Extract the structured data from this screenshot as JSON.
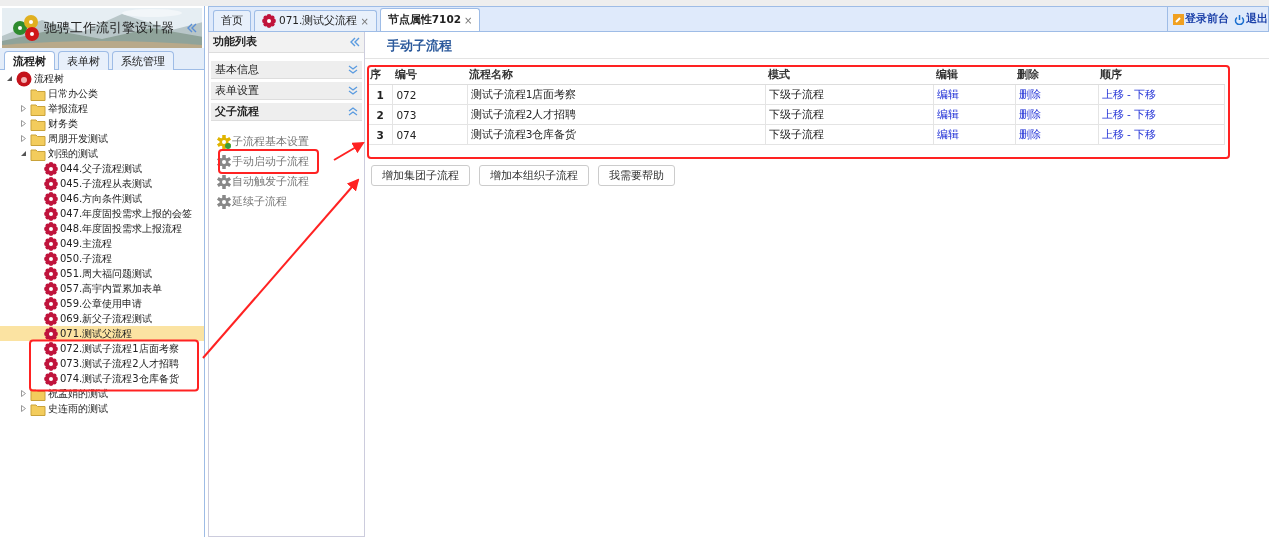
{
  "sidebar": {
    "title": "驰骋工作流引擎设计器",
    "tabs": [
      {
        "label": "流程树",
        "selected": true
      },
      {
        "label": "表单树",
        "selected": false
      },
      {
        "label": "系统管理",
        "selected": false
      }
    ],
    "tree": [
      {
        "label": "流程树",
        "kind": "root",
        "expanded": true,
        "selected": false,
        "children": [
          {
            "label": "日常办公类",
            "kind": "folder",
            "selected": false
          },
          {
            "label": "举报流程",
            "kind": "folder",
            "expanded": false,
            "selected": false
          },
          {
            "label": "财务类",
            "kind": "folder",
            "expanded": false,
            "selected": false
          },
          {
            "label": "周朋开发测试",
            "kind": "folder",
            "expanded": false,
            "selected": false
          },
          {
            "label": "刘强的测试",
            "kind": "folder",
            "expanded": true,
            "selected": false,
            "children": [
              {
                "label": "044.父子流程测试",
                "kind": "process",
                "selected": false
              },
              {
                "label": "045.子流程从表测试",
                "kind": "process",
                "selected": false
              },
              {
                "label": "046.方向条件测试",
                "kind": "process",
                "selected": false
              },
              {
                "label": "047.年度固投需求上报的会签",
                "kind": "process",
                "selected": false
              },
              {
                "label": "048.年度固投需求上报流程",
                "kind": "process",
                "selected": false
              },
              {
                "label": "049.主流程",
                "kind": "process",
                "selected": false
              },
              {
                "label": "050.子流程",
                "kind": "process",
                "selected": false
              },
              {
                "label": "051.周大福问题测试",
                "kind": "process",
                "selected": false
              },
              {
                "label": "057.高宇内置累加表单",
                "kind": "process",
                "selected": false
              },
              {
                "label": "059.公章使用申请",
                "kind": "process",
                "selected": false
              },
              {
                "label": "069.新父子流程测试",
                "kind": "process",
                "selected": false
              },
              {
                "label": "071.测试父流程",
                "kind": "process",
                "selected": true
              },
              {
                "label": "072.测试子流程1店面考察",
                "kind": "process",
                "selected": false
              },
              {
                "label": "073.测试子流程2人才招聘",
                "kind": "process",
                "selected": false
              },
              {
                "label": "074.测试子流程3仓库备货",
                "kind": "process",
                "selected": false
              }
            ]
          },
          {
            "label": "祝孟娟的测试",
            "kind": "folder",
            "expanded": false,
            "selected": false
          },
          {
            "label": "史连雨的测试",
            "kind": "folder",
            "expanded": false,
            "selected": false
          }
        ]
      }
    ]
  },
  "tabs": [
    {
      "label": "首页",
      "kind": "plain",
      "selected": false
    },
    {
      "label": "071.测试父流程",
      "kind": "process",
      "selected": false
    },
    {
      "label": "节点属性7102",
      "kind": "plain",
      "selected": true
    }
  ],
  "close_marks": [
    "×",
    "×"
  ],
  "header_links": [
    {
      "label": "登录前台",
      "kind": "key"
    },
    {
      "label": "退出",
      "kind": "power"
    }
  ],
  "function_list": {
    "title": "功能列表",
    "sections": [
      {
        "label": "基本信息",
        "expanded": false
      },
      {
        "label": "表单设置",
        "expanded": false
      },
      {
        "label": "父子流程",
        "expanded": true,
        "items": [
          {
            "label": "子流程基本设置",
            "kind": "settings"
          },
          {
            "label": "手动启动子流程",
            "kind": "gear"
          },
          {
            "label": "自动触发子流程",
            "kind": "gear"
          },
          {
            "label": "延续子流程",
            "kind": "gear"
          }
        ]
      }
    ]
  },
  "content": {
    "title": "手动子流程",
    "table": {
      "columns": [
        "序",
        "编号",
        "流程名称",
        "模式",
        "编辑",
        "删除",
        "顺序"
      ],
      "rows": [
        {
          "index": "1",
          "code": "072",
          "name": "测试子流程1店面考察",
          "mode": "下级子流程",
          "edit": "编辑",
          "delete": "删除",
          "up": "上移",
          "sep": "-",
          "down": "下移"
        },
        {
          "index": "2",
          "code": "073",
          "name": "测试子流程2人才招聘",
          "mode": "下级子流程",
          "edit": "编辑",
          "delete": "删除",
          "up": "上移",
          "sep": "-",
          "down": "下移"
        },
        {
          "index": "3",
          "code": "074",
          "name": "测试子流程3仓库备货",
          "mode": "下级子流程",
          "edit": "编辑",
          "delete": "删除",
          "up": "上移",
          "sep": "-",
          "down": "下移"
        }
      ]
    },
    "buttons": [
      "增加集团子流程",
      "增加本组织子流程",
      "我需要帮助"
    ]
  }
}
